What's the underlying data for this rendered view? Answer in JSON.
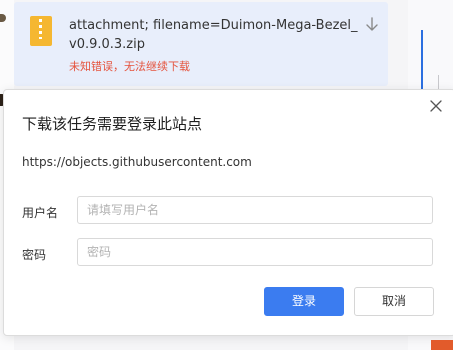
{
  "download": {
    "filename": "attachment; filename=Duimon-Mega-Bezel_v0.9.0.3.zip",
    "error": "未知错误，无法继续下载",
    "file_icon": "zip-file-icon",
    "action_icon": "download-arrow-icon"
  },
  "dialog": {
    "title": "下载该任务需要登录此站点",
    "site": "https://objects.githubusercontent.com",
    "close_icon": "close-icon",
    "username": {
      "label": "用户名",
      "placeholder": "请填写用户名",
      "value": ""
    },
    "password": {
      "label": "密码",
      "placeholder": "密码",
      "value": ""
    },
    "login_label": "登录",
    "cancel_label": "取消"
  },
  "colors": {
    "primary": "#3b7cf0",
    "error": "#e5533d",
    "card_bg": "#e8eefb",
    "file_icon": "#f5b731"
  }
}
